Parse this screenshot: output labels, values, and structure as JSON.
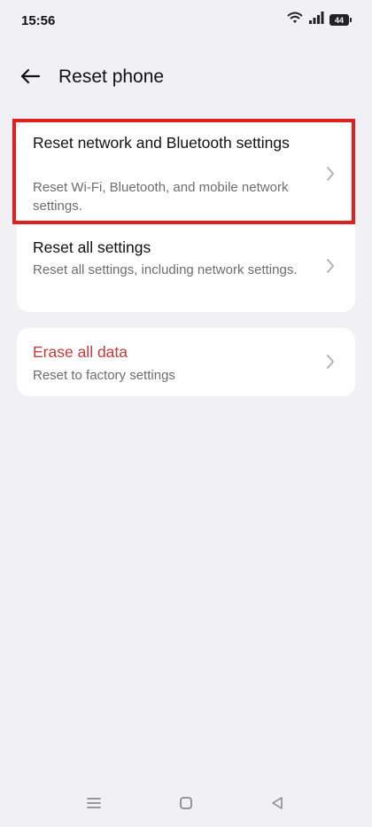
{
  "status_bar": {
    "time": "15:56",
    "battery_level": "44",
    "icons": [
      "wifi-icon",
      "signal-icon",
      "battery-icon"
    ]
  },
  "header": {
    "title": "Reset phone",
    "back_icon": "back-arrow-icon"
  },
  "options": [
    {
      "title": "Reset network and Bluetooth settings",
      "subtitle": "Reset Wi-Fi, Bluetooth, and mobile network settings.",
      "icon": "chevron-right-icon"
    },
    {
      "title": "Reset all settings",
      "subtitle": "Reset all settings, including network settings.",
      "icon": "chevron-right-icon"
    }
  ],
  "danger_option": {
    "title": "Erase all data",
    "subtitle": "Reset to factory settings",
    "icon": "chevron-right-icon",
    "title_color": "#c8393b"
  },
  "highlight": {
    "color": "#e02020"
  },
  "nav_bar": {
    "icons": [
      "menu-icon",
      "home-icon",
      "back-icon"
    ]
  }
}
